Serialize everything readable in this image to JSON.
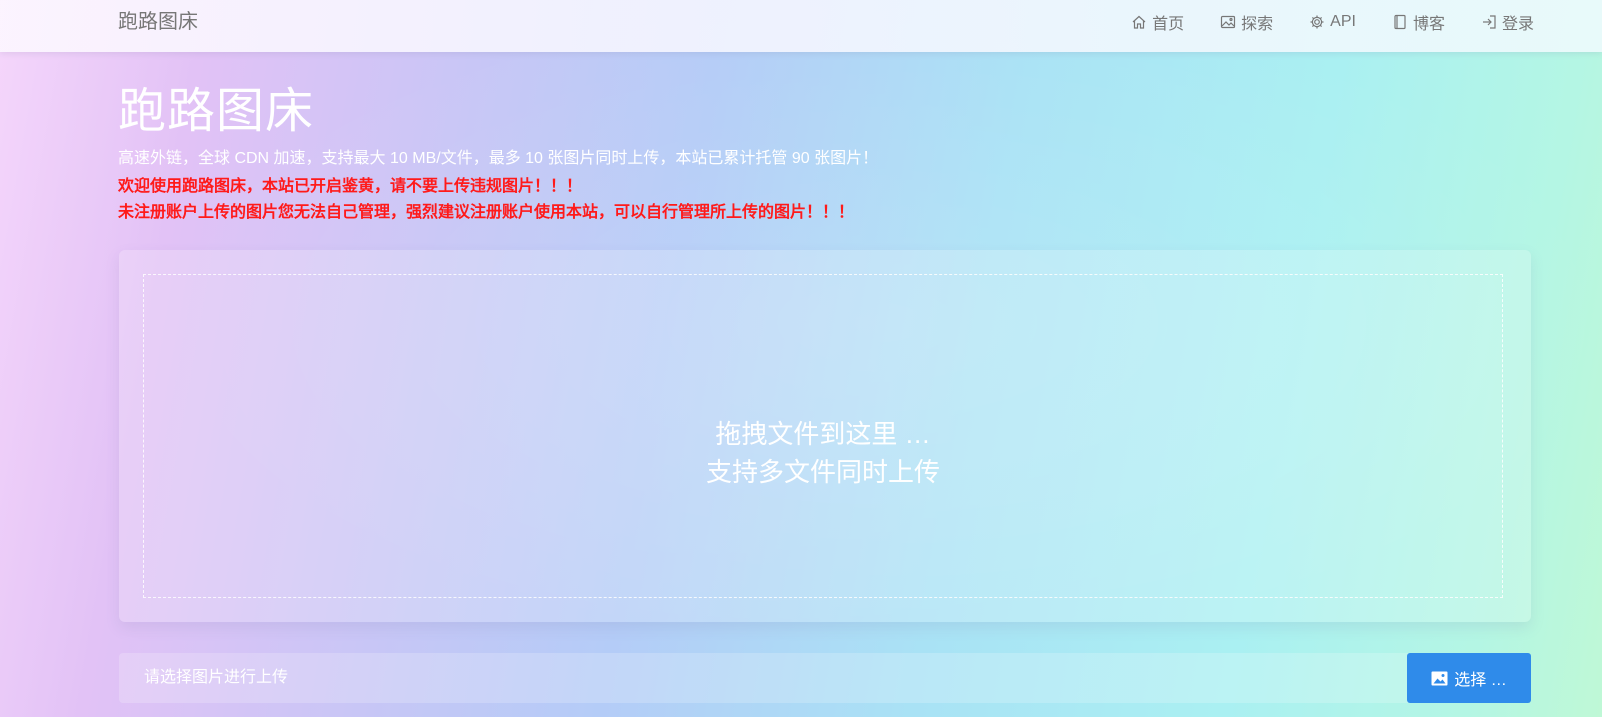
{
  "navbar": {
    "brand": "跑路图床",
    "items": [
      {
        "icon": "home-icon",
        "label": "首页"
      },
      {
        "icon": "image-icon",
        "label": "探索"
      },
      {
        "icon": "gear-icon",
        "label": "API"
      },
      {
        "icon": "book-icon",
        "label": "博客"
      },
      {
        "icon": "login-icon",
        "label": "登录"
      }
    ]
  },
  "hero": {
    "title": "跑路图床",
    "subtitle": "高速外链，全球 CDN 加速，支持最大 10 MB/文件，最多 10 张图片同时上传，本站已累计托管 90 张图片！",
    "warning1": "欢迎使用跑路图床，本站已开启鉴黄，请不要上传违规图片！！！",
    "warning2": "未注册账户上传的图片您无法自己管理，强烈建议注册账户使用本站，可以自行管理所上传的图片！！！"
  },
  "dropzone": {
    "line1": "拖拽文件到这里 …",
    "line2": "支持多文件同时上传"
  },
  "upload": {
    "placeholder": "请选择图片进行上传",
    "button_label": "选择 …"
  },
  "colors": {
    "button": "#2f8bea",
    "warning": "#ff1a1a",
    "nav_text": "#777777"
  }
}
